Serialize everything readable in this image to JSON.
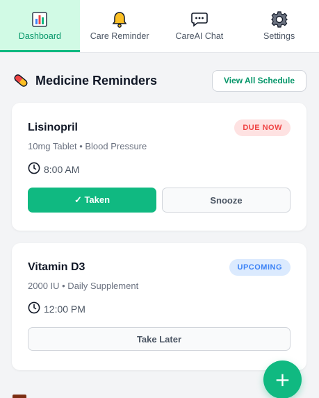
{
  "tabs": [
    {
      "label": "Dashboard",
      "icon": "bar-chart-icon",
      "active": true
    },
    {
      "label": "Care Reminder",
      "icon": "bell-icon",
      "active": false
    },
    {
      "label": "CareAI Chat",
      "icon": "chat-bubble-icon",
      "active": false
    },
    {
      "label": "Settings",
      "icon": "gear-icon",
      "active": false
    }
  ],
  "section": {
    "title": "Medicine Reminders",
    "icon": "pill-icon",
    "view_all_label": "View All Schedule"
  },
  "reminders": [
    {
      "name": "Lisinopril",
      "status": "DUE NOW",
      "detail": "10mg Tablet • Blood Pressure",
      "time": "8:00 AM",
      "taken_label": "✓ Taken",
      "snooze_label": "Snooze"
    },
    {
      "name": "Vitamin D3",
      "status": "UPCOMING",
      "detail": "2000 IU • Daily Supplement",
      "time": "12:00 PM",
      "later_label": "Take Later"
    }
  ],
  "fab": {
    "label": "+",
    "icon": "plus-icon"
  },
  "colors": {
    "accent": "#10b981",
    "accent_light": "#d1fae5",
    "due_bg": "#fee2e2",
    "due_text": "#ef4444",
    "upcoming_bg": "#dbeafe",
    "upcoming_text": "#3b82f6"
  }
}
